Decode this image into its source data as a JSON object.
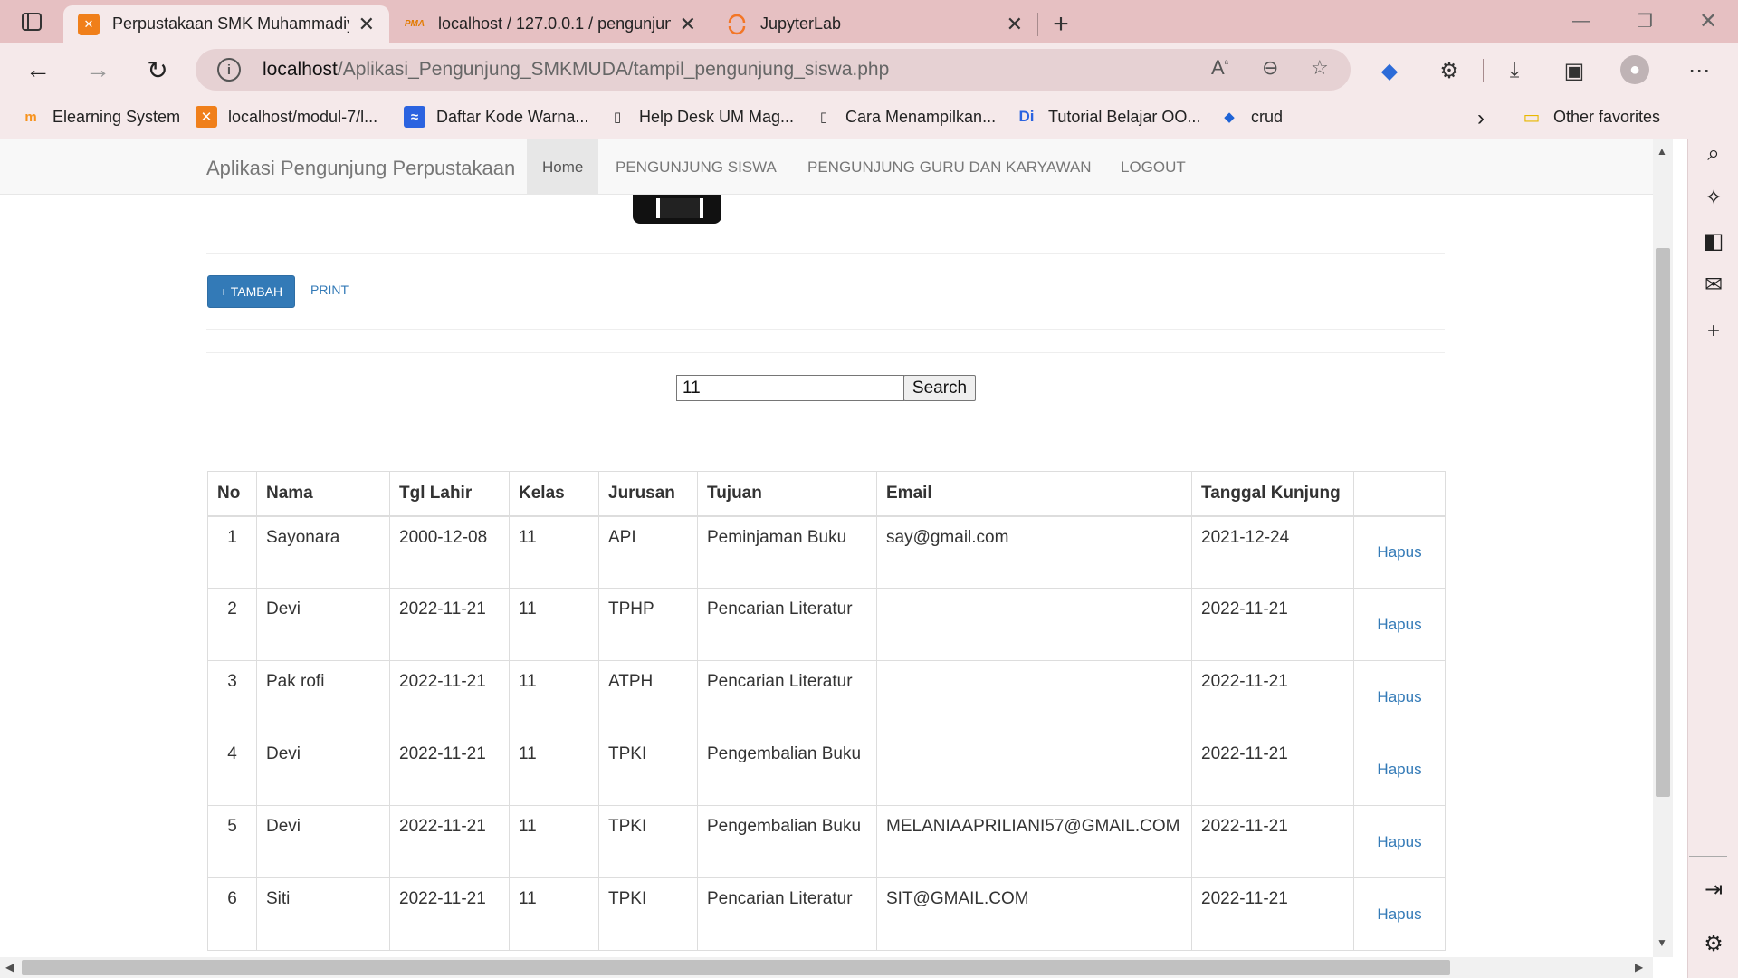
{
  "browser": {
    "tabs": [
      {
        "title": "Perpustakaan SMK Muhammadiy",
        "favicon": "xampp-icon",
        "active": true
      },
      {
        "title": "localhost / 127.0.0.1 / pengunjun",
        "favicon": "phpmyadmin-icon",
        "favicon_label": "PMA",
        "active": false
      },
      {
        "title": "JupyterLab",
        "favicon": "jupyter-icon",
        "active": false
      }
    ],
    "address": {
      "host": "localhost",
      "path": "/Aplikasi_Pengunjung_SMKMUDA/tampil_pengunjung_siswa.php"
    },
    "bookmarks": [
      {
        "label": "Elearning System",
        "icon": "moodle-icon",
        "icon_glyph": "m"
      },
      {
        "label": "localhost/modul-7/l...",
        "icon": "xampp-icon",
        "icon_glyph": "✕"
      },
      {
        "label": "Daftar Kode Warna...",
        "icon": "chart-icon",
        "icon_glyph": "≈"
      },
      {
        "label": "Help Desk UM Mag...",
        "icon": "page-icon",
        "icon_glyph": "▯"
      },
      {
        "label": "Cara Menampilkan...",
        "icon": "page-icon",
        "icon_glyph": "▯"
      },
      {
        "label": "Tutorial Belajar OO...",
        "icon": "di-icon",
        "icon_glyph": "Di"
      },
      {
        "label": "crud",
        "icon": "diamond-icon",
        "icon_glyph": "◆"
      }
    ],
    "other_favorites": "Other favorites"
  },
  "app": {
    "brand": "Aplikasi Pengunjung Perpustakaan",
    "nav": [
      {
        "label": "Home",
        "active": true
      },
      {
        "label": "PENGUNJUNG SISWA",
        "active": false
      },
      {
        "label": "PENGUNJUNG GURU DAN KARYAWAN",
        "active": false
      },
      {
        "label": "LOGOUT",
        "active": false
      }
    ],
    "buttons": {
      "tambah": "+ TAMBAH",
      "print": "PRINT"
    },
    "search": {
      "value": "11",
      "button": "Search"
    },
    "table": {
      "headers": [
        "No",
        "Nama",
        "Tgl Lahir",
        "Kelas",
        "Jurusan",
        "Tujuan",
        "Email",
        "Tanggal Kunjung",
        ""
      ],
      "rows": [
        {
          "no": "1",
          "nama": "Sayonara",
          "tgl_lahir": "2000-12-08",
          "kelas": "11",
          "jurusan": "API",
          "tujuan": "Peminjaman Buku",
          "email": "say@gmail.com",
          "tanggal_kunjung": "2021-12-24",
          "action": "Hapus"
        },
        {
          "no": "2",
          "nama": "Devi",
          "tgl_lahir": "2022-11-21",
          "kelas": "11",
          "jurusan": "TPHP",
          "tujuan": "Pencarian Literatur",
          "email": "",
          "tanggal_kunjung": "2022-11-21",
          "action": "Hapus"
        },
        {
          "no": "3",
          "nama": "Pak rofi",
          "tgl_lahir": "2022-11-21",
          "kelas": "11",
          "jurusan": "ATPH",
          "tujuan": "Pencarian Literatur",
          "email": "",
          "tanggal_kunjung": "2022-11-21",
          "action": "Hapus"
        },
        {
          "no": "4",
          "nama": "Devi",
          "tgl_lahir": "2022-11-21",
          "kelas": "11",
          "jurusan": "TPKI",
          "tujuan": "Pengembalian Buku",
          "email": "",
          "tanggal_kunjung": "2022-11-21",
          "action": "Hapus"
        },
        {
          "no": "5",
          "nama": "Devi",
          "tgl_lahir": "2022-11-21",
          "kelas": "11",
          "jurusan": "TPKI",
          "tujuan": "Pengembalian Buku",
          "email": "MELANIAAPRILIANI57@GMAIL.COM",
          "tanggal_kunjung": "2022-11-21",
          "action": "Hapus"
        },
        {
          "no": "6",
          "nama": "Siti",
          "tgl_lahir": "2022-11-21",
          "kelas": "11",
          "jurusan": "TPKI",
          "tujuan": "Pencarian Literatur",
          "email": "SIT@GMAIL.COM",
          "tanggal_kunjung": "2022-11-21",
          "action": "Hapus"
        }
      ]
    }
  },
  "colors": {
    "primary": "#337ab7",
    "browser_frame": "#e6c0c2",
    "browser_toolbar": "#f5e9ea"
  }
}
